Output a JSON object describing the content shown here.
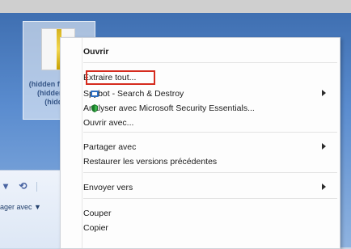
{
  "context_menu": {
    "items": [
      {
        "label": "Ouvrir"
      },
      {
        "label": "Extraire tout..."
      },
      {
        "label": "Spybot - Search & Destroy"
      },
      {
        "label": "Analyser avec Microsoft Security Essentials..."
      },
      {
        "label": "Ouvrir avec..."
      },
      {
        "label": "Partager avec"
      },
      {
        "label": "Restaurer les versions précédentes"
      },
      {
        "label": "Envoyer vers"
      },
      {
        "label": "Couper"
      },
      {
        "label": "Copier"
      }
    ]
  },
  "desktop": {
    "file_label_lines": [
      "(hidden filename)",
      "(hidden text)",
      "(hidden)"
    ]
  },
  "explorer": {
    "share_button_label": "ager avec ▼"
  },
  "colors": {
    "highlight_border": "#d52b1e",
    "menu_bg": "#fdfdfd"
  },
  "icons": {
    "spybot": "spybot-icon",
    "security_essentials": "security-essentials-icon",
    "zip_file": "zip-file-icon"
  }
}
